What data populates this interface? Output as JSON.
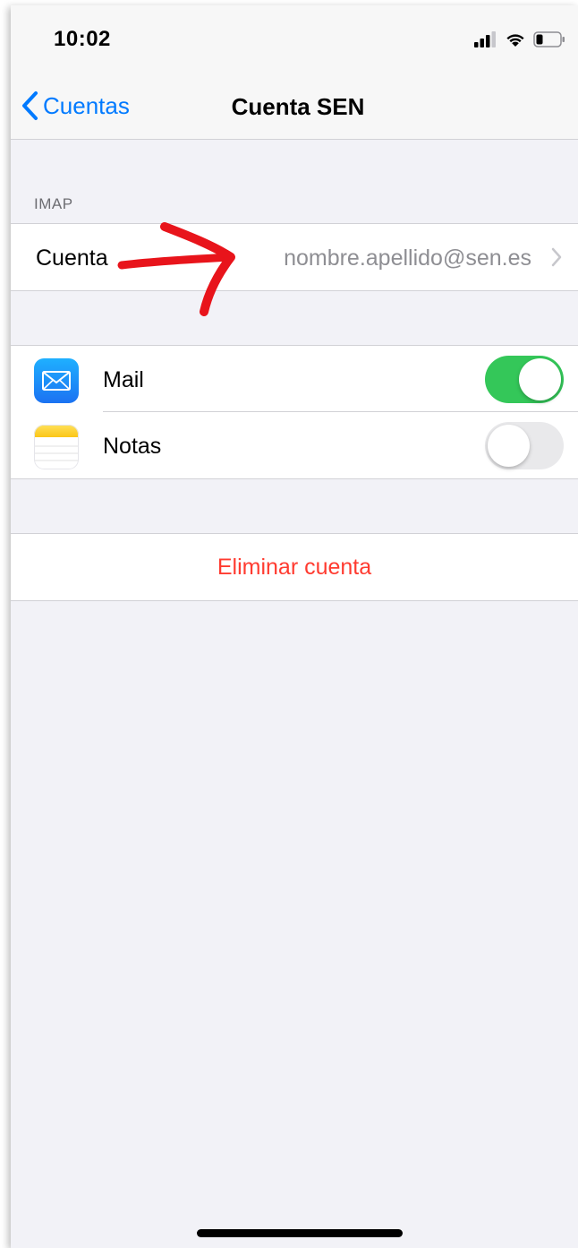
{
  "status_bar": {
    "time": "10:02"
  },
  "nav": {
    "back_label": "Cuentas",
    "title": "Cuenta SEN"
  },
  "imap_section": {
    "header": "IMAP",
    "account_label": "Cuenta",
    "account_value": "nombre.apellido@sen.es"
  },
  "apps": [
    {
      "name": "Mail",
      "icon": "mail-icon",
      "enabled": true
    },
    {
      "name": "Notas",
      "icon": "notes-icon",
      "enabled": false
    }
  ],
  "delete_button": {
    "label": "Eliminar cuenta"
  },
  "colors": {
    "accent": "#007aff",
    "toggle_on": "#34c759",
    "destructive": "#ff3b30",
    "annotation_arrow": "#e8141b"
  }
}
